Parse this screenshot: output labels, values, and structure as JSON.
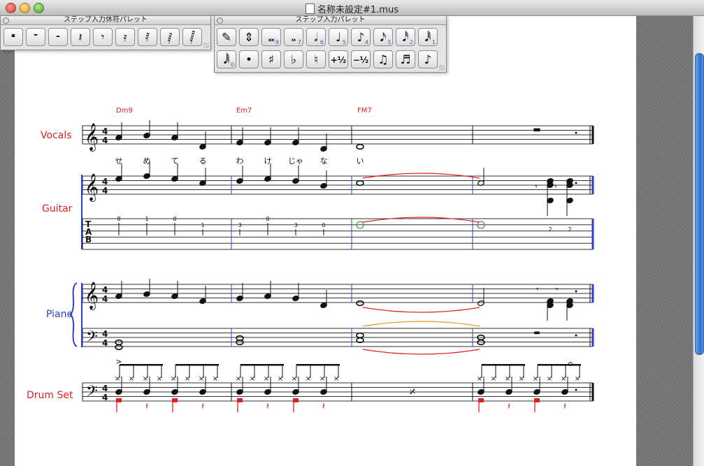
{
  "window": {
    "title": "名称未設定#1.mus"
  },
  "rest_palette": {
    "title": "ステップ入力休符パレット",
    "buttons": [
      {
        "glyph": "𝄺"
      },
      {
        "glyph": "𝄻"
      },
      {
        "glyph": "𝄼"
      },
      {
        "glyph": "𝄽"
      },
      {
        "glyph": "𝄾"
      },
      {
        "glyph": "𝄿"
      },
      {
        "glyph": "𝅀"
      },
      {
        "glyph": "𝅁"
      },
      {
        "glyph": "𝅂"
      }
    ]
  },
  "note_palette": {
    "title": "ステップ入力パレット",
    "row1": [
      {
        "glyph": "✎",
        "sub": ""
      },
      {
        "glyph": "⇕",
        "sub": ""
      },
      {
        "glyph": "𝅜",
        "sub": "9"
      },
      {
        "glyph": "𝅝",
        "sub": "7"
      },
      {
        "glyph": "𝅗𝅥",
        "sub": "6"
      },
      {
        "glyph": "♩",
        "sub": "5"
      },
      {
        "glyph": "♪",
        "sub": "4"
      },
      {
        "glyph": "𝅘𝅥𝅯",
        "sub": "3"
      },
      {
        "glyph": "𝅘𝅥𝅰",
        "sub": "2"
      },
      {
        "glyph": "𝅘𝅥𝅱",
        "sub": "1"
      }
    ],
    "row2": [
      {
        "glyph": "𝅘𝅥𝅲",
        "sub": "0"
      },
      {
        "glyph": "•",
        "sub": ""
      },
      {
        "glyph": "♯",
        "sub": ""
      },
      {
        "glyph": "♭",
        "sub": ""
      },
      {
        "glyph": "♮",
        "sub": ""
      },
      {
        "glyph": "+½",
        "sub": ""
      },
      {
        "glyph": "−½",
        "sub": ""
      },
      {
        "glyph": "♫",
        "sub": ""
      },
      {
        "glyph": "♬",
        "sub": ""
      },
      {
        "glyph": "♪",
        "sub": ""
      }
    ]
  },
  "score": {
    "time_signature": {
      "top": "4",
      "bottom": "4"
    },
    "tab_letters": [
      "T",
      "A",
      "B"
    ],
    "chords": [
      "Dm9",
      "Em7",
      "FM7"
    ],
    "lyrics": [
      "せ",
      "め",
      "て",
      "る",
      "わ",
      "け",
      "じゃ",
      "な",
      "い"
    ],
    "tab_numbers": [
      "8",
      "1",
      "0",
      "1",
      "3",
      "0",
      "3",
      "0",
      "2",
      "2"
    ],
    "instruments": [
      {
        "name": "Vocals",
        "color": "#e02020"
      },
      {
        "name": "Guitar",
        "color": "#e02020"
      },
      {
        "name": "Piano",
        "color": "#2a3fd0"
      },
      {
        "name": "Drum Set",
        "color": "#e02020"
      }
    ],
    "glyphs": {
      "treble": "𝄞",
      "bass": "𝄢",
      "rest_whole": "▬",
      "repeat": "𝄎",
      "accent": ">"
    }
  }
}
